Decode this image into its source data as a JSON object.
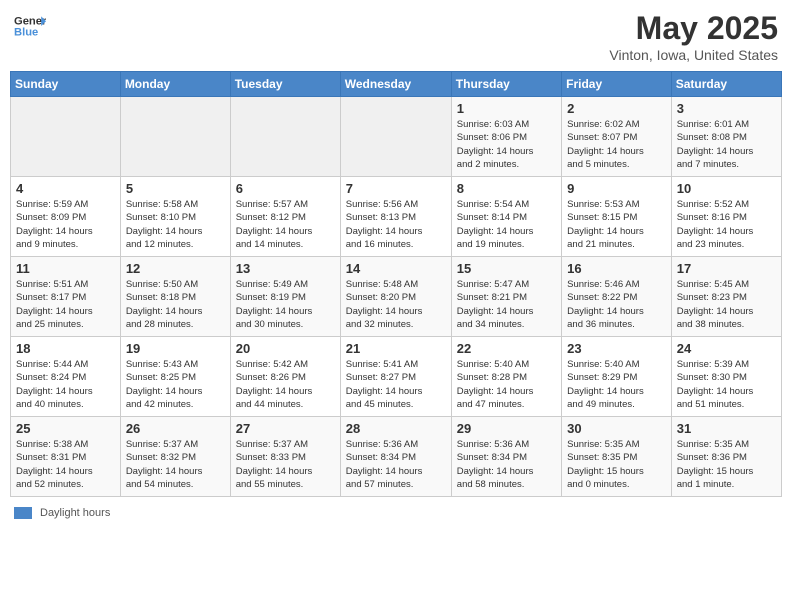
{
  "header": {
    "logo_line1": "General",
    "logo_line2": "Blue",
    "month": "May 2025",
    "location": "Vinton, Iowa, United States"
  },
  "days_of_week": [
    "Sunday",
    "Monday",
    "Tuesday",
    "Wednesday",
    "Thursday",
    "Friday",
    "Saturday"
  ],
  "weeks": [
    [
      {
        "day": "",
        "info": ""
      },
      {
        "day": "",
        "info": ""
      },
      {
        "day": "",
        "info": ""
      },
      {
        "day": "",
        "info": ""
      },
      {
        "day": "1",
        "info": "Sunrise: 6:03 AM\nSunset: 8:06 PM\nDaylight: 14 hours\nand 2 minutes."
      },
      {
        "day": "2",
        "info": "Sunrise: 6:02 AM\nSunset: 8:07 PM\nDaylight: 14 hours\nand 5 minutes."
      },
      {
        "day": "3",
        "info": "Sunrise: 6:01 AM\nSunset: 8:08 PM\nDaylight: 14 hours\nand 7 minutes."
      }
    ],
    [
      {
        "day": "4",
        "info": "Sunrise: 5:59 AM\nSunset: 8:09 PM\nDaylight: 14 hours\nand 9 minutes."
      },
      {
        "day": "5",
        "info": "Sunrise: 5:58 AM\nSunset: 8:10 PM\nDaylight: 14 hours\nand 12 minutes."
      },
      {
        "day": "6",
        "info": "Sunrise: 5:57 AM\nSunset: 8:12 PM\nDaylight: 14 hours\nand 14 minutes."
      },
      {
        "day": "7",
        "info": "Sunrise: 5:56 AM\nSunset: 8:13 PM\nDaylight: 14 hours\nand 16 minutes."
      },
      {
        "day": "8",
        "info": "Sunrise: 5:54 AM\nSunset: 8:14 PM\nDaylight: 14 hours\nand 19 minutes."
      },
      {
        "day": "9",
        "info": "Sunrise: 5:53 AM\nSunset: 8:15 PM\nDaylight: 14 hours\nand 21 minutes."
      },
      {
        "day": "10",
        "info": "Sunrise: 5:52 AM\nSunset: 8:16 PM\nDaylight: 14 hours\nand 23 minutes."
      }
    ],
    [
      {
        "day": "11",
        "info": "Sunrise: 5:51 AM\nSunset: 8:17 PM\nDaylight: 14 hours\nand 25 minutes."
      },
      {
        "day": "12",
        "info": "Sunrise: 5:50 AM\nSunset: 8:18 PM\nDaylight: 14 hours\nand 28 minutes."
      },
      {
        "day": "13",
        "info": "Sunrise: 5:49 AM\nSunset: 8:19 PM\nDaylight: 14 hours\nand 30 minutes."
      },
      {
        "day": "14",
        "info": "Sunrise: 5:48 AM\nSunset: 8:20 PM\nDaylight: 14 hours\nand 32 minutes."
      },
      {
        "day": "15",
        "info": "Sunrise: 5:47 AM\nSunset: 8:21 PM\nDaylight: 14 hours\nand 34 minutes."
      },
      {
        "day": "16",
        "info": "Sunrise: 5:46 AM\nSunset: 8:22 PM\nDaylight: 14 hours\nand 36 minutes."
      },
      {
        "day": "17",
        "info": "Sunrise: 5:45 AM\nSunset: 8:23 PM\nDaylight: 14 hours\nand 38 minutes."
      }
    ],
    [
      {
        "day": "18",
        "info": "Sunrise: 5:44 AM\nSunset: 8:24 PM\nDaylight: 14 hours\nand 40 minutes."
      },
      {
        "day": "19",
        "info": "Sunrise: 5:43 AM\nSunset: 8:25 PM\nDaylight: 14 hours\nand 42 minutes."
      },
      {
        "day": "20",
        "info": "Sunrise: 5:42 AM\nSunset: 8:26 PM\nDaylight: 14 hours\nand 44 minutes."
      },
      {
        "day": "21",
        "info": "Sunrise: 5:41 AM\nSunset: 8:27 PM\nDaylight: 14 hours\nand 45 minutes."
      },
      {
        "day": "22",
        "info": "Sunrise: 5:40 AM\nSunset: 8:28 PM\nDaylight: 14 hours\nand 47 minutes."
      },
      {
        "day": "23",
        "info": "Sunrise: 5:40 AM\nSunset: 8:29 PM\nDaylight: 14 hours\nand 49 minutes."
      },
      {
        "day": "24",
        "info": "Sunrise: 5:39 AM\nSunset: 8:30 PM\nDaylight: 14 hours\nand 51 minutes."
      }
    ],
    [
      {
        "day": "25",
        "info": "Sunrise: 5:38 AM\nSunset: 8:31 PM\nDaylight: 14 hours\nand 52 minutes."
      },
      {
        "day": "26",
        "info": "Sunrise: 5:37 AM\nSunset: 8:32 PM\nDaylight: 14 hours\nand 54 minutes."
      },
      {
        "day": "27",
        "info": "Sunrise: 5:37 AM\nSunset: 8:33 PM\nDaylight: 14 hours\nand 55 minutes."
      },
      {
        "day": "28",
        "info": "Sunrise: 5:36 AM\nSunset: 8:34 PM\nDaylight: 14 hours\nand 57 minutes."
      },
      {
        "day": "29",
        "info": "Sunrise: 5:36 AM\nSunset: 8:34 PM\nDaylight: 14 hours\nand 58 minutes."
      },
      {
        "day": "30",
        "info": "Sunrise: 5:35 AM\nSunset: 8:35 PM\nDaylight: 15 hours\nand 0 minutes."
      },
      {
        "day": "31",
        "info": "Sunrise: 5:35 AM\nSunset: 8:36 PM\nDaylight: 15 hours\nand 1 minute."
      }
    ]
  ],
  "legend": {
    "label": "Daylight hours"
  }
}
